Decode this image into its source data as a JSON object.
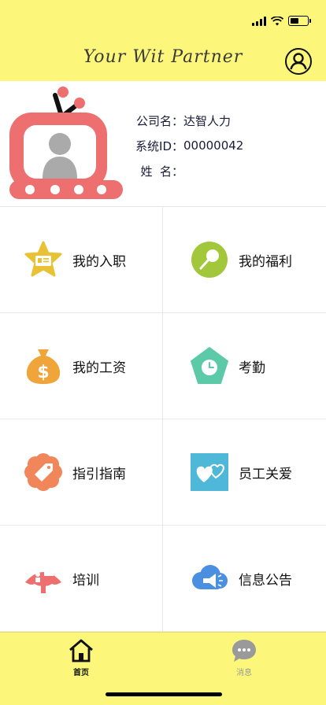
{
  "status_bar": {
    "battery_level": 0.5,
    "icons": [
      "signal-icon",
      "wifi-icon",
      "battery-icon"
    ]
  },
  "header": {
    "title": "Your Wit Partner",
    "profile_icon": "user-circle-icon"
  },
  "profile": {
    "company_label": "公司名：",
    "company_value": "达智人力",
    "system_id_label": "系统ID：",
    "system_id_value": "00000042",
    "name_label": "姓  名：",
    "name_value": ""
  },
  "menu": [
    {
      "label": "我的入职",
      "icon": "star-id-card-icon",
      "color": "#E8C234"
    },
    {
      "label": "我的福利",
      "icon": "lollipop-icon",
      "color": "#A2C73B"
    },
    {
      "label": "我的工资",
      "icon": "money-bag-icon",
      "color": "#F0A53A"
    },
    {
      "label": "考勤",
      "icon": "pentagon-clock-icon",
      "color": "#5CC9A7"
    },
    {
      "label": "指引指南",
      "icon": "flower-tag-icon",
      "color": "#F0865A"
    },
    {
      "label": "员工关爱",
      "icon": "hearts-icon",
      "color": "#4FB8D8"
    },
    {
      "label": "培训",
      "icon": "fan-training-icon",
      "color": "#EE6F6F"
    },
    {
      "label": "信息公告",
      "icon": "cloud-megaphone-icon",
      "color": "#4A8FE0"
    }
  ],
  "tabbar": {
    "home_label": "首页",
    "messages_label": "消息"
  },
  "colors": {
    "brand_yellow": "#FCF77A",
    "tv_red": "#EE6F6F"
  }
}
